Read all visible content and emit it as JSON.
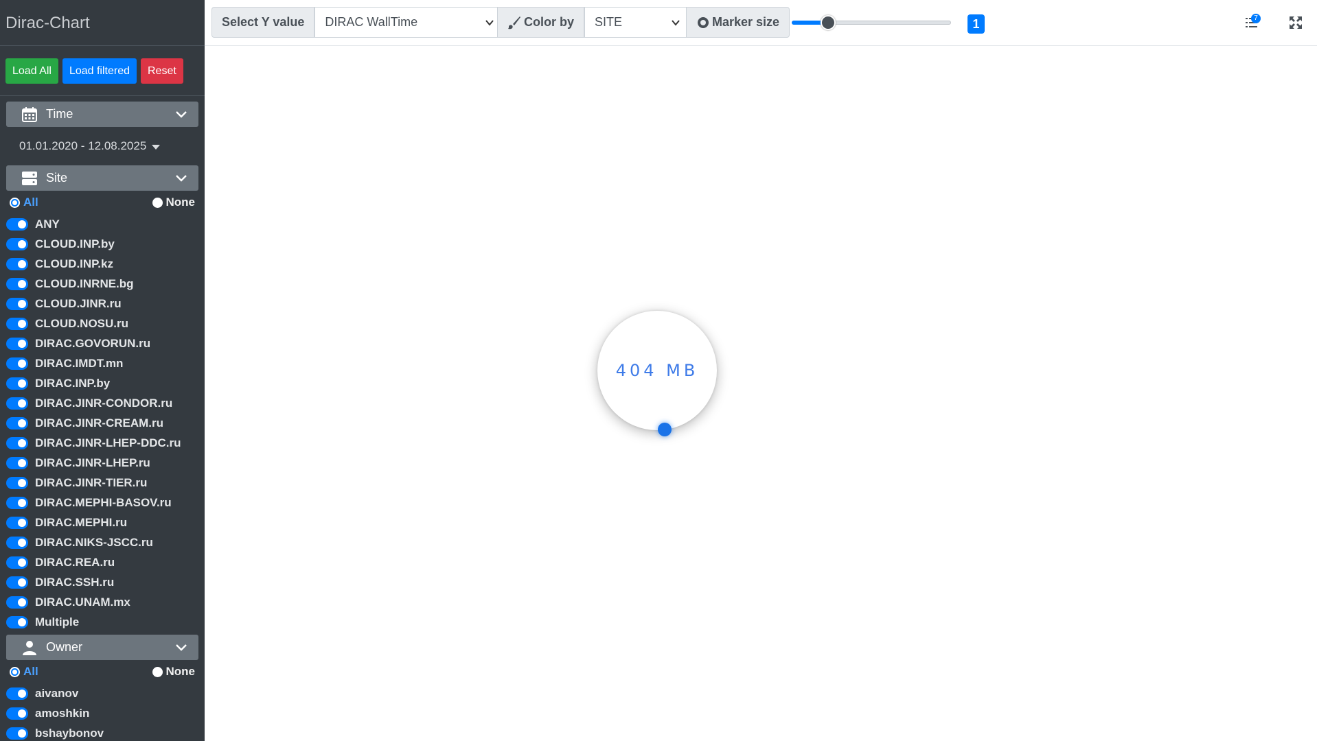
{
  "sidebar": {
    "brand": "Dirac-Chart",
    "buttons": {
      "load_all": "Load All",
      "load_filtered": "Load filtered",
      "reset": "Reset"
    },
    "time": {
      "header": "Time",
      "range": "01.01.2020 - 12.08.2025"
    },
    "site": {
      "header": "Site",
      "all_label": "All",
      "none_label": "None",
      "selected": "All",
      "items": [
        "ANY",
        "CLOUD.INP.by",
        "CLOUD.INP.kz",
        "CLOUD.INRNE.bg",
        "CLOUD.JINR.ru",
        "CLOUD.NOSU.ru",
        "DIRAC.GOVORUN.ru",
        "DIRAC.IMDT.mn",
        "DIRAC.INP.by",
        "DIRAC.JINR-CONDOR.ru",
        "DIRAC.JINR-CREAM.ru",
        "DIRAC.JINR-LHEP-DDC.ru",
        "DIRAC.JINR-LHEP.ru",
        "DIRAC.JINR-TIER.ru",
        "DIRAC.MEPHI-BASOV.ru",
        "DIRAC.MEPHI.ru",
        "DIRAC.NIKS-JSCC.ru",
        "DIRAC.REA.ru",
        "DIRAC.SSH.ru",
        "DIRAC.UNAM.mx",
        "Multiple"
      ]
    },
    "owner": {
      "header": "Owner",
      "all_label": "All",
      "none_label": "None",
      "selected": "All",
      "items": [
        "aivanov",
        "amoshkin",
        "bshaybonov"
      ]
    }
  },
  "toolbar": {
    "y_label": "Select Y value",
    "y_value": "DIRAC WallTime",
    "color_label": "Color by",
    "color_value": "SITE",
    "marker_label": "Marker size",
    "marker_level": 0.2,
    "marker_value": "1",
    "notification_count": "7",
    "icons": [
      "paint-brush-icon",
      "circle-icon",
      "list-icon",
      "expand-icon"
    ]
  },
  "main": {
    "loader_text": "404 MB"
  },
  "colors": {
    "sidebar_bg": "#343a40",
    "primary": "#007bff",
    "success": "#28a745",
    "danger": "#dc3545",
    "section_bg": "#6c757d"
  }
}
